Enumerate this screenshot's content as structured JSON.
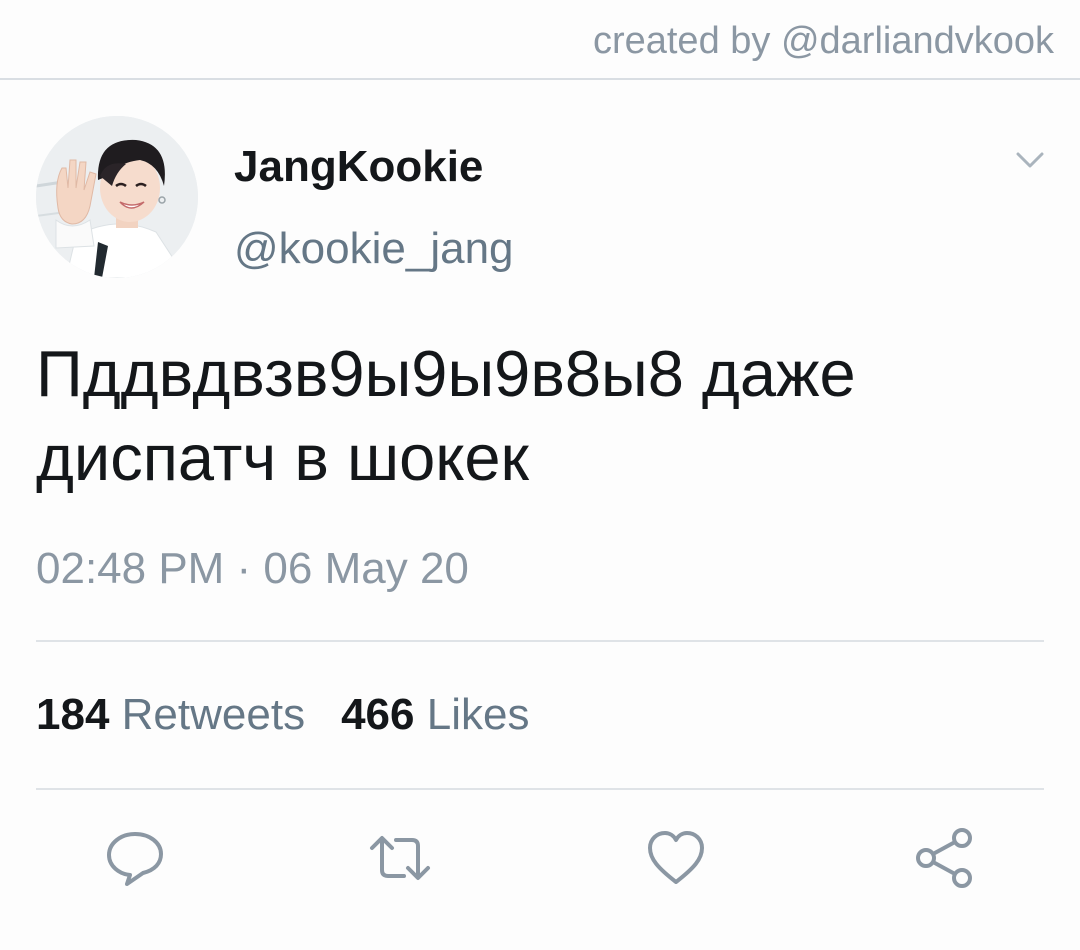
{
  "credit": {
    "text": "created by @darliandvkook"
  },
  "tweet": {
    "author": {
      "display_name": "JangKookie",
      "handle": "@kookie_jang"
    },
    "text": "Пддвдвзв9ы9ы9в8ы8 даже диспатч в шокек",
    "timestamp": "02:48 PM · 06 May 20",
    "stats": {
      "retweets_count": "184",
      "retweets_label": "Retweets",
      "likes_count": "466",
      "likes_label": "Likes"
    },
    "actions": {
      "reply_icon": "reply-icon",
      "retweet_icon": "retweet-icon",
      "like_icon": "heart-icon",
      "share_icon": "share-icon"
    }
  },
  "colors": {
    "text_primary": "#14171a",
    "text_secondary": "#657786",
    "icon_gray": "#8b97a3",
    "divider": "#dfe3e7"
  }
}
